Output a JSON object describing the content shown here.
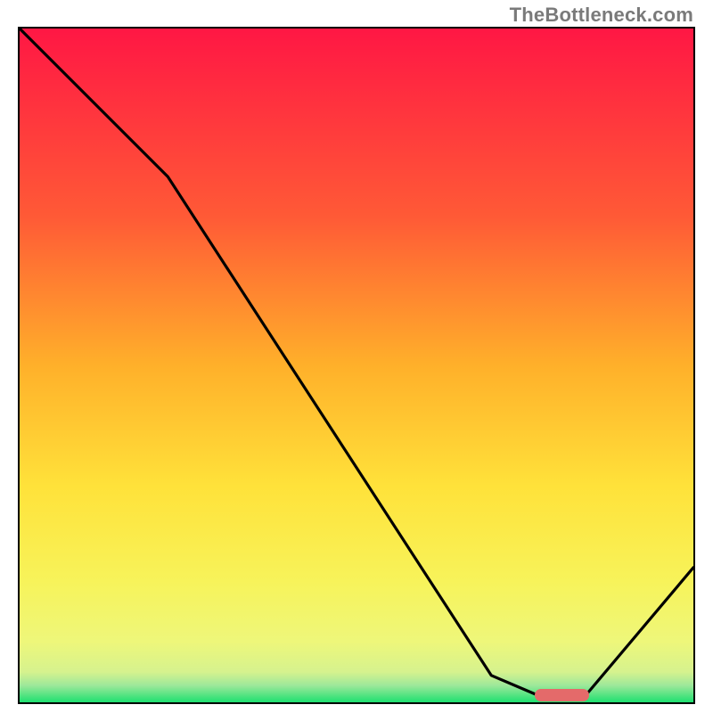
{
  "watermark": "TheBottleneck.com",
  "chart_data": {
    "type": "line",
    "title": "",
    "xlabel": "",
    "ylabel": "",
    "xlim": [
      0,
      100
    ],
    "ylim": [
      0,
      100
    ],
    "grid": false,
    "legend": false,
    "gradient_colors": {
      "top": "#ff1744",
      "upper_mid": "#ff8a2a",
      "mid": "#ffd83a",
      "lower_mid": "#f7f35a",
      "lower": "#e6f98e",
      "bottom": "#1ee070"
    },
    "series": [
      {
        "name": "bottleneck-curve",
        "x": [
          0,
          22,
          70,
          77,
          84,
          100
        ],
        "y": [
          100,
          78,
          4,
          1,
          1,
          20
        ]
      }
    ],
    "marker": {
      "name": "optimal-range",
      "x_start": 77,
      "x_end": 84,
      "y": 1,
      "color": "#e46a6a"
    },
    "annotations": []
  }
}
